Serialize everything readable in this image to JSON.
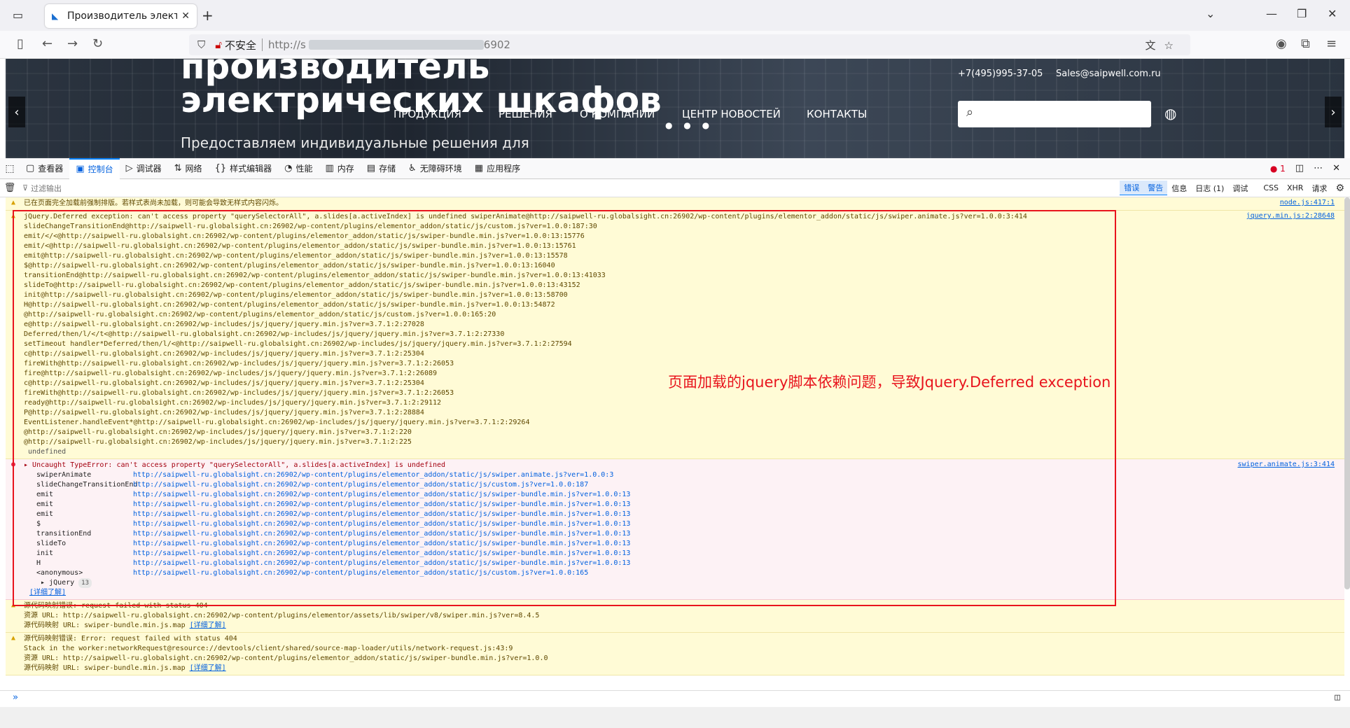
{
  "browser": {
    "tab_title": "Производитель электричес",
    "url_insecure_label": "不安全",
    "url_text": "http://s",
    "url_tail": "6902"
  },
  "website": {
    "heading_line1": "производитель",
    "heading_line2": "электрических шкафов",
    "subheading": "Предоставляем индивидуальные решения для",
    "menu": [
      "ПРОДУКЦИЯ",
      "РЕШЕНИЯ",
      "О КОМПАНИИ",
      "ЦЕНТР НОВОСТЕЙ",
      "КОНТАКТЫ"
    ],
    "phone": "+7(495)995-37-05",
    "email": "Sales@saipwell.com.ru"
  },
  "devtools": {
    "tabs": [
      "查看器",
      "控制台",
      "调试器",
      "网络",
      "样式编辑器",
      "性能",
      "内存",
      "存储",
      "无障碍环境",
      "应用程序"
    ],
    "active_tab": "控制台",
    "error_count": "1",
    "filter_placeholder": "过滤输出",
    "levels": [
      "错误",
      "警告",
      "信息",
      "日志 (1)",
      "调试"
    ],
    "extra_filters": [
      "CSS",
      "XHR",
      "请求"
    ]
  },
  "console": {
    "msg0": {
      "text": "已在页面完全加载前强制排版。若样式表尚未加载，则可能会导致无样式内容闪烁。",
      "source": "node.js:417:1"
    },
    "msg1": {
      "source": "jquery.min.js:2:28648",
      "lines": [
        "jQuery.Deferred exception: can't access property \"querySelectorAll\", a.slides[a.activeIndex] is undefined swiperAnimate@http://saipwell-ru.globalsight.cn:26902/wp-content/plugins/elementor_addon/static/js/swiper.animate.js?ver=1.0.0:3:414",
        "slideChangeTransitionEnd@http://saipwell-ru.globalsight.cn:26902/wp-content/plugins/elementor_addon/static/js/custom.js?ver=1.0.0:187:30",
        "emit/</<@http://saipwell-ru.globalsight.cn:26902/wp-content/plugins/elementor_addon/static/js/swiper-bundle.min.js?ver=1.0.0:13:15776",
        "emit/<@http://saipwell-ru.globalsight.cn:26902/wp-content/plugins/elementor_addon/static/js/swiper-bundle.min.js?ver=1.0.0:13:15761",
        "emit@http://saipwell-ru.globalsight.cn:26902/wp-content/plugins/elementor_addon/static/js/swiper-bundle.min.js?ver=1.0.0:13:15578",
        "$@http://saipwell-ru.globalsight.cn:26902/wp-content/plugins/elementor_addon/static/js/swiper-bundle.min.js?ver=1.0.0:13:16040",
        "transitionEnd@http://saipwell-ru.globalsight.cn:26902/wp-content/plugins/elementor_addon/static/js/swiper-bundle.min.js?ver=1.0.0:13:41033",
        "slideTo@http://saipwell-ru.globalsight.cn:26902/wp-content/plugins/elementor_addon/static/js/swiper-bundle.min.js?ver=1.0.0:13:43152",
        "init@http://saipwell-ru.globalsight.cn:26902/wp-content/plugins/elementor_addon/static/js/swiper-bundle.min.js?ver=1.0.0:13:58700",
        "H@http://saipwell-ru.globalsight.cn:26902/wp-content/plugins/elementor_addon/static/js/swiper-bundle.min.js?ver=1.0.0:13:54872",
        "@http://saipwell-ru.globalsight.cn:26902/wp-content/plugins/elementor_addon/static/js/custom.js?ver=1.0.0:165:20",
        "e@http://saipwell-ru.globalsight.cn:26902/wp-includes/js/jquery/jquery.min.js?ver=3.7.1:2:27028",
        "Deferred/then/l/</t<@http://saipwell-ru.globalsight.cn:26902/wp-includes/js/jquery/jquery.min.js?ver=3.7.1:2:27330",
        "setTimeout handler*Deferred/then/l/<@http://saipwell-ru.globalsight.cn:26902/wp-includes/js/jquery/jquery.min.js?ver=3.7.1:2:27594",
        "c@http://saipwell-ru.globalsight.cn:26902/wp-includes/js/jquery/jquery.min.js?ver=3.7.1:2:25304",
        "fireWith@http://saipwell-ru.globalsight.cn:26902/wp-includes/js/jquery/jquery.min.js?ver=3.7.1:2:26053",
        "fire@http://saipwell-ru.globalsight.cn:26902/wp-includes/js/jquery/jquery.min.js?ver=3.7.1:2:26089",
        "c@http://saipwell-ru.globalsight.cn:26902/wp-includes/js/jquery/jquery.min.js?ver=3.7.1:2:25304",
        "fireWith@http://saipwell-ru.globalsight.cn:26902/wp-includes/js/jquery/jquery.min.js?ver=3.7.1:2:26053",
        "ready@http://saipwell-ru.globalsight.cn:26902/wp-includes/js/jquery/jquery.min.js?ver=3.7.1:2:29112",
        "P@http://saipwell-ru.globalsight.cn:26902/wp-includes/js/jquery/jquery.min.js?ver=3.7.1:2:28884",
        "EventListener.handleEvent*@http://saipwell-ru.globalsight.cn:26902/wp-includes/js/jquery/jquery.min.js?ver=3.7.1:2:29264",
        "@http://saipwell-ru.globalsight.cn:26902/wp-includes/js/jquery/jquery.min.js?ver=3.7.1:2:220",
        "@http://saipwell-ru.globalsight.cn:26902/wp-includes/js/jquery/jquery.min.js?ver=3.7.1:2:225",
        " undefined"
      ]
    },
    "msg2": {
      "title": "Uncaught TypeError: can't access property \"querySelectorAll\", a.slides[a.activeIndex] is undefined",
      "source": "swiper.animate.js:3:414",
      "stack": [
        {
          "fn": "swiperAnimate",
          "loc": "http://saipwell-ru.globalsight.cn:26902/wp-content/plugins/elementor_addon/static/js/swiper.animate.js?ver=1.0.0:3"
        },
        {
          "fn": "slideChangeTransitionEnd",
          "loc": "http://saipwell-ru.globalsight.cn:26902/wp-content/plugins/elementor_addon/static/js/custom.js?ver=1.0.0:187"
        },
        {
          "fn": "emit",
          "loc": "http://saipwell-ru.globalsight.cn:26902/wp-content/plugins/elementor_addon/static/js/swiper-bundle.min.js?ver=1.0.0:13"
        },
        {
          "fn": "emit",
          "loc": "http://saipwell-ru.globalsight.cn:26902/wp-content/plugins/elementor_addon/static/js/swiper-bundle.min.js?ver=1.0.0:13"
        },
        {
          "fn": "emit",
          "loc": "http://saipwell-ru.globalsight.cn:26902/wp-content/plugins/elementor_addon/static/js/swiper-bundle.min.js?ver=1.0.0:13"
        },
        {
          "fn": "$",
          "loc": "http://saipwell-ru.globalsight.cn:26902/wp-content/plugins/elementor_addon/static/js/swiper-bundle.min.js?ver=1.0.0:13"
        },
        {
          "fn": "transitionEnd",
          "loc": "http://saipwell-ru.globalsight.cn:26902/wp-content/plugins/elementor_addon/static/js/swiper-bundle.min.js?ver=1.0.0:13"
        },
        {
          "fn": "slideTo",
          "loc": "http://saipwell-ru.globalsight.cn:26902/wp-content/plugins/elementor_addon/static/js/swiper-bundle.min.js?ver=1.0.0:13"
        },
        {
          "fn": "init",
          "loc": "http://saipwell-ru.globalsight.cn:26902/wp-content/plugins/elementor_addon/static/js/swiper-bundle.min.js?ver=1.0.0:13"
        },
        {
          "fn": "H",
          "loc": "http://saipwell-ru.globalsight.cn:26902/wp-content/plugins/elementor_addon/static/js/swiper-bundle.min.js?ver=1.0.0:13"
        },
        {
          "fn": "<anonymous>",
          "loc": "http://saipwell-ru.globalsight.cn:26902/wp-content/plugins/elementor_addon/static/js/custom.js?ver=1.0.0:165"
        }
      ],
      "jquery_group": "jQuery",
      "jquery_count": "13",
      "learn_more": "[详细了解]"
    },
    "msg3": {
      "lines": [
        "源代码映射错误: request failed with status 404",
        "资源 URL: http://saipwell-ru.globalsight.cn:26902/wp-content/plugins/elementor/assets/lib/swiper/v8/swiper.min.js?ver=8.4.5",
        "源代码映射 URL: swiper-bundle.min.js.map"
      ],
      "learn_more": "[详细了解]"
    },
    "msg4": {
      "lines": [
        "源代码映射错误: Error: request failed with status 404",
        "Stack in the worker:networkRequest@resource://devtools/client/shared/source-map-loader/utils/network-request.js:43:9",
        "",
        "资源 URL: http://saipwell-ru.globalsight.cn:26902/wp-content/plugins/elementor_addon/static/js/swiper-bundle.min.js?ver=1.0.0",
        "源代码映射 URL: swiper-bundle.min.js.map"
      ],
      "learn_more": "[详细了解]"
    },
    "prompt": "»"
  },
  "annotation": {
    "text": "页面加载的jquery脚本依赖问题，导致Jquery.Deferred exception",
    "color": "#e8141d"
  }
}
